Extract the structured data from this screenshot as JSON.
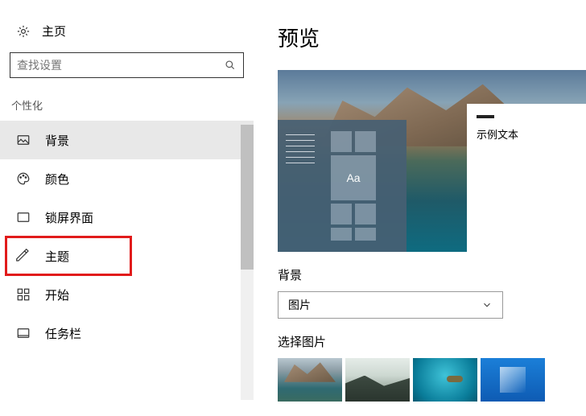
{
  "header": {
    "home_label": "主页"
  },
  "search": {
    "placeholder": "查找设置"
  },
  "section_title": "个性化",
  "nav": {
    "items": [
      {
        "label": "背景"
      },
      {
        "label": "颜色"
      },
      {
        "label": "锁屏界面"
      },
      {
        "label": "主题"
      },
      {
        "label": "开始"
      },
      {
        "label": "任务栏"
      }
    ],
    "selected_index": 0,
    "highlighted_index": 3
  },
  "main": {
    "title": "预览",
    "preview_sample_text": "示例文本",
    "preview_tile_text": "Aa",
    "background_label": "背景",
    "background_dropdown_value": "图片",
    "choose_picture_label": "选择图片"
  }
}
